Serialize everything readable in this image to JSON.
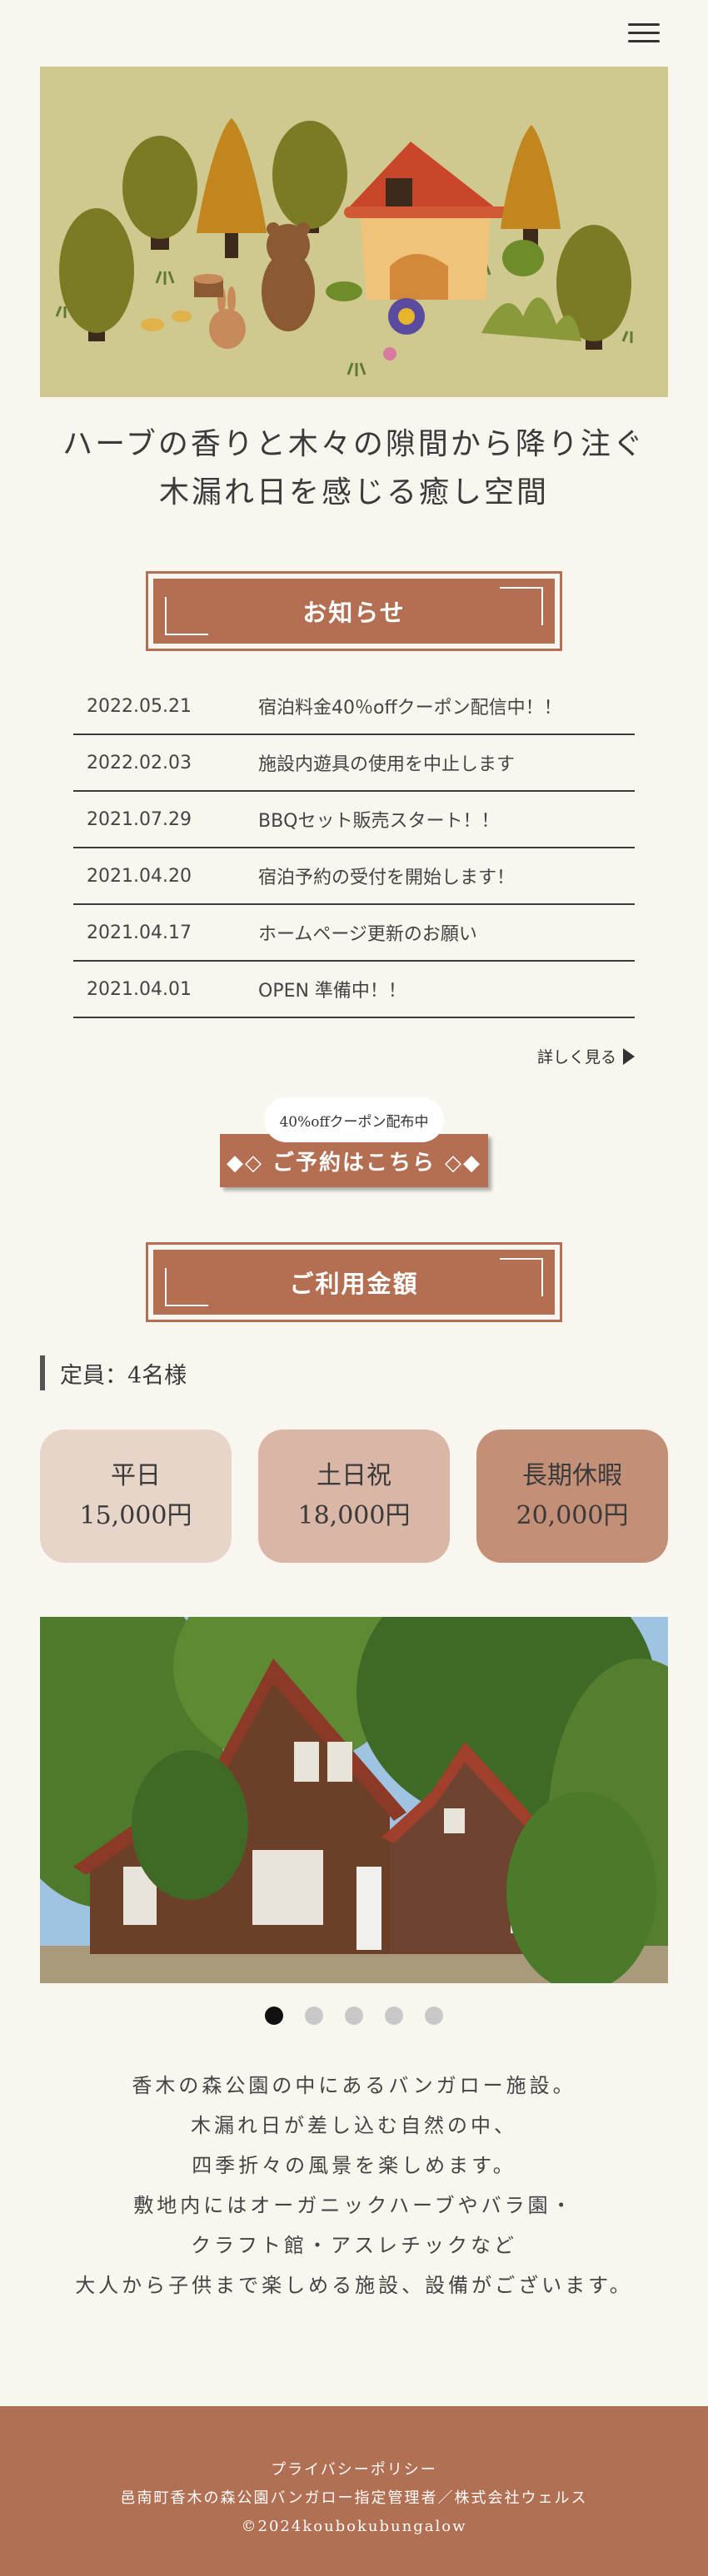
{
  "header": {
    "menu_icon": "hamburger-menu-icon"
  },
  "hero": {
    "tagline_line1": "ハーブの香りと木々の隙間から降り注ぐ",
    "tagline_line2": "木漏れ日を感じる癒し空間"
  },
  "news": {
    "title": "お知らせ",
    "items": [
      {
        "date": "2022.05.21",
        "text": "宿泊料金40％offクーポン配信中！！"
      },
      {
        "date": "2022.02.03",
        "text": "施設内遊具の使用を中止します"
      },
      {
        "date": "2021.07.29",
        "text": "BBQセット販売スタート！！"
      },
      {
        "date": "2021.04.20",
        "text": "宿泊予約の受付を開始します！"
      },
      {
        "date": "2021.04.17",
        "text": "ホームページ更新のお願い"
      },
      {
        "date": "2021.04.01",
        "text": "OPEN 準備中！！"
      }
    ],
    "more_label": "詳しく見る"
  },
  "reserve": {
    "badge": "40%offクーポン配布中",
    "button_label": "◆◇ ご予約はこちら ◇◆"
  },
  "pricing": {
    "title": "ご利用金額",
    "capacity": "定員：4名様",
    "plans": [
      {
        "label": "平日",
        "price": "15,000円",
        "color": "#e8d5c9"
      },
      {
        "label": "土日祝",
        "price": "18,000円",
        "color": "#d9b6a5"
      },
      {
        "label": "長期休暇",
        "price": "20,000円",
        "color": "#c48f77"
      }
    ]
  },
  "slider": {
    "count": 5,
    "active": 1
  },
  "intro": {
    "lines": [
      "香木の森公園の中にあるバンガロー施設。",
      "木漏れ日が差し込む自然の中、",
      "四季折々の風景を楽しめます。",
      "敷地内にはオーガニックハーブやバラ園・",
      "クラフト館・アスレチックなど",
      "大人から子供まで楽しめる施設、設備がございます。"
    ]
  },
  "footer": {
    "privacy": "プライバシーポリシー",
    "manager": "邑南町香木の森公園バンガロー指定管理者／株式会社ウェルス",
    "copyright": "©2024koubokubungalow"
  },
  "colors": {
    "accent": "#b46f53",
    "background": "#f9f6f0",
    "hero_bg": "#cfc98f"
  }
}
